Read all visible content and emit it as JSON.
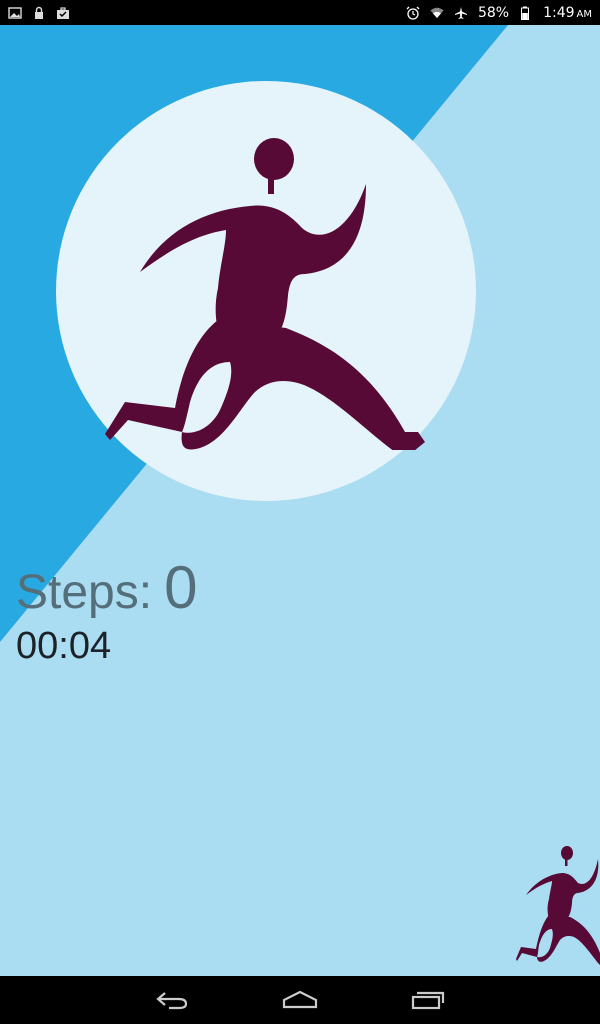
{
  "status_bar": {
    "left_icons": [
      "gallery-icon",
      "lock-icon",
      "briefcase-check-icon"
    ],
    "right_icons": [
      "alarm-icon",
      "wifi-icon",
      "airplane-icon",
      "battery-icon"
    ],
    "battery_text": "58%",
    "time": "1:49",
    "time_suffix": "AM"
  },
  "app": {
    "steps_label": "Steps:",
    "steps_value": "0",
    "timer": "00:04",
    "hero_icon": "running-person-icon",
    "fab_icon": "running-person-icon"
  },
  "colors": {
    "background_light": "#aadcf2",
    "background_dark": "#29a9e1",
    "circle": "#e5f4fb",
    "runner": "#560a35",
    "steps_text": "#546e7a",
    "timer_text": "#1c2226"
  },
  "nav_bar": {
    "buttons": [
      "back-icon",
      "home-icon",
      "recents-icon"
    ]
  }
}
